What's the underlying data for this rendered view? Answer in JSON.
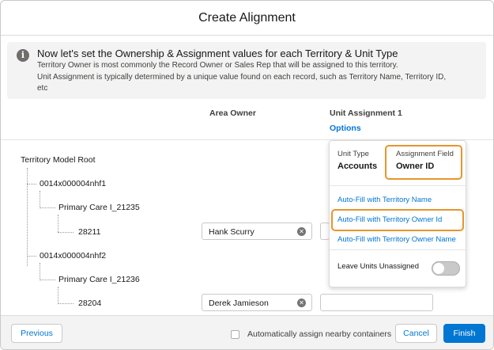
{
  "modal": {
    "title": "Create Alignment"
  },
  "info": {
    "title": "Now let's set the Ownership & Assignment values for each Territory & Unit Type",
    "line1": "Territory Owner is most commonly the Record Owner or Sales Rep that will be assigned to this territory.",
    "line2": "Unit Assignment is typically determined by a unique value found on each record, such as Territory Name, Territory ID,",
    "line3": "etc"
  },
  "columns": {
    "area_owner": "Area Owner",
    "unit_assignment": "Unit Assignment 1",
    "options_link": "Options"
  },
  "tree": {
    "root": "Territory Model Root",
    "nodes": [
      {
        "label": "0014x000004nhf1"
      },
      {
        "label": "Primary Care I_21235"
      },
      {
        "label": "28211",
        "owner": "Hank Scurry"
      },
      {
        "label": "0014x000004nhf2"
      },
      {
        "label": "Primary Care I_21236"
      },
      {
        "label": "28204",
        "owner": "Derek Jamieson"
      }
    ]
  },
  "popover": {
    "unit_type_label": "Unit Type",
    "unit_type_value": "Accounts",
    "assignment_field_label": "Assignment Field",
    "assignment_field_value": "Owner ID",
    "options": [
      "Auto-Fill with Territory Name",
      "Auto-Fill with Territory Owner Id",
      "Auto-Fill with Territory Owner Name"
    ],
    "toggle_label": "Leave Units Unassigned",
    "toggle_on": false
  },
  "footer": {
    "previous": "Previous",
    "auto_assign_label": "Automatically assign nearby containers",
    "cancel": "Cancel",
    "finish": "Finish"
  },
  "colors": {
    "brand": "#0176d3",
    "highlight": "#e8952b"
  }
}
